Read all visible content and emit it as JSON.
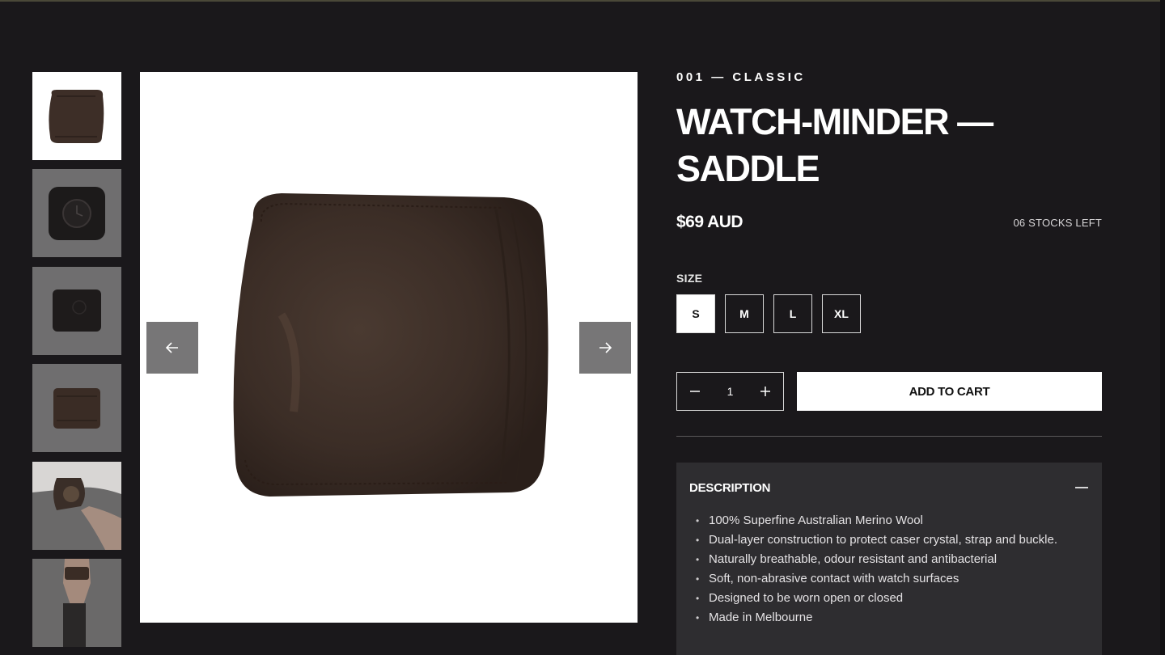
{
  "product": {
    "eyebrow": "001 — CLASSIC",
    "title_line1": "WATCH-MINDER —",
    "title_line2": "SADDLE",
    "price": "$69 AUD",
    "stock": "06 STOCKS LEFT",
    "image_alt": "Watch-Minder Saddle brown merino wool sleeve"
  },
  "size": {
    "label": "SIZE",
    "options": [
      "S",
      "M",
      "L",
      "XL"
    ],
    "selected": "S"
  },
  "cart": {
    "quantity": "1",
    "add_label": "ADD TO CART"
  },
  "description": {
    "title": "DESCRIPTION",
    "items": [
      "100% Superfine Australian Merino Wool",
      "Dual-layer construction to protect caser crystal, strap and buckle.",
      "Naturally breathable, odour resistant and antibacterial",
      "Soft, non-abrasive contact with watch surfaces",
      "Designed to be worn open or closed",
      "Made in Melbourne"
    ]
  },
  "gallery": {
    "thumbnail_count": 6,
    "active_index": 0
  },
  "colors": {
    "background": "#1a181b",
    "product_brown": "#3d2e27",
    "thumb_bg": "#777677"
  }
}
